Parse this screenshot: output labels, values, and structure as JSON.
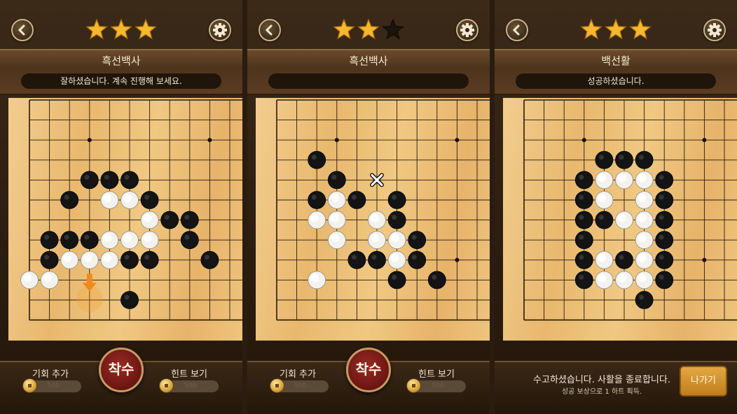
{
  "panels": [
    {
      "title": "흑선백사",
      "message": "잘하셨습니다. 계속 진행해 보세요.",
      "stars": 3,
      "bottom": {
        "left_label": "기회 추가",
        "left_cost": "500",
        "center_label": "착수",
        "right_label": "힌트 보기",
        "right_cost": "500"
      }
    },
    {
      "title": "흑선백사",
      "message": "",
      "stars": 2,
      "bottom": {
        "left_label": "기회 추가",
        "left_cost": "500",
        "center_label": "착수",
        "right_label": "힌트 보기",
        "right_cost": "500"
      }
    },
    {
      "title": "백선활",
      "message": "성공하셨습니다.",
      "stars": 3,
      "status": {
        "line1": "수고하셨습니다. 사활을 종료합니다.",
        "line2": "성공 보상으로 1 하트 획득."
      },
      "exit_label": "나가기"
    }
  ],
  "boards": [
    {
      "black": [
        [
          3,
          4
        ],
        [
          4,
          4
        ],
        [
          5,
          4
        ],
        [
          2,
          5
        ],
        [
          6,
          5
        ],
        [
          7,
          6
        ],
        [
          8,
          6
        ],
        [
          1,
          7
        ],
        [
          2,
          7
        ],
        [
          3,
          7
        ],
        [
          8,
          7
        ],
        [
          1,
          8
        ],
        [
          5,
          8
        ],
        [
          6,
          8
        ],
        [
          9,
          8
        ],
        [
          5,
          10
        ]
      ],
      "white": [
        [
          4,
          5
        ],
        [
          5,
          5
        ],
        [
          6,
          6
        ],
        [
          4,
          7
        ],
        [
          5,
          7
        ],
        [
          6,
          7
        ],
        [
          2,
          8
        ],
        [
          3,
          8
        ],
        [
          4,
          8
        ],
        [
          0,
          9
        ],
        [
          1,
          9
        ]
      ],
      "hint_arrow": [
        3,
        9
      ]
    },
    {
      "black": [
        [
          2,
          3
        ],
        [
          3,
          4
        ],
        [
          2,
          5
        ],
        [
          4,
          5
        ],
        [
          6,
          5
        ],
        [
          6,
          6
        ],
        [
          7,
          7
        ],
        [
          4,
          8
        ],
        [
          5,
          8
        ],
        [
          7,
          8
        ],
        [
          6,
          9
        ],
        [
          8,
          9
        ]
      ],
      "white": [
        [
          3,
          5
        ],
        [
          2,
          6
        ],
        [
          3,
          6
        ],
        [
          5,
          6
        ],
        [
          3,
          7
        ],
        [
          5,
          7
        ],
        [
          6,
          7
        ],
        [
          6,
          8
        ],
        [
          2,
          9
        ]
      ],
      "cross_mark": [
        5,
        4
      ]
    },
    {
      "black": [
        [
          4,
          3
        ],
        [
          5,
          3
        ],
        [
          6,
          3
        ],
        [
          3,
          4
        ],
        [
          7,
          4
        ],
        [
          3,
          5
        ],
        [
          7,
          5
        ],
        [
          3,
          6
        ],
        [
          4,
          6
        ],
        [
          7,
          6
        ],
        [
          3,
          7
        ],
        [
          7,
          7
        ],
        [
          3,
          8
        ],
        [
          5,
          8
        ],
        [
          7,
          8
        ],
        [
          3,
          9
        ],
        [
          7,
          9
        ],
        [
          6,
          10
        ]
      ],
      "white": [
        [
          4,
          4
        ],
        [
          5,
          4
        ],
        [
          6,
          4
        ],
        [
          4,
          5
        ],
        [
          6,
          5
        ],
        [
          5,
          6
        ],
        [
          6,
          6
        ],
        [
          6,
          7
        ],
        [
          4,
          8
        ],
        [
          6,
          8
        ],
        [
          4,
          9
        ],
        [
          5,
          9
        ],
        [
          6,
          9
        ]
      ]
    }
  ]
}
